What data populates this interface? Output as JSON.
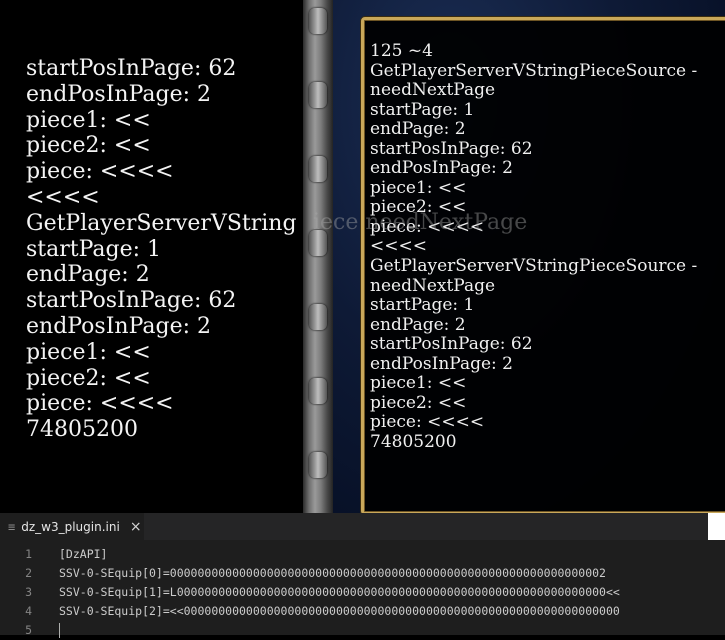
{
  "game": {
    "left_lines": [
      "startPosInPage: 62",
      "endPosInPage: 2",
      "piece1: <<",
      "piece2: <<",
      "piece: <<<<",
      "<<<<",
      "GetPlayerServerVString",
      "startPage: 1",
      "endPage: 2",
      "startPosInPage: 62",
      "endPosInPage: 2",
      "piece1: <<",
      "piece2: <<",
      "piece: <<<<",
      "74805200"
    ],
    "overlay_text": "iece needNextPage",
    "dialog_lines": [
      "125 ~4",
      "GetPlayerServerVStringPieceSource -",
      "needNextPage",
      "startPage: 1",
      "endPage: 2",
      "startPosInPage: 62",
      "endPosInPage: 2",
      "piece1: <<",
      "piece2: <<",
      "piece: <<<<",
      "<<<<",
      "GetPlayerServerVStringPieceSource -",
      "needNextPage",
      "startPage: 1",
      "endPage: 2",
      "startPosInPage: 62",
      "endPosInPage: 2",
      "piece1: <<",
      "piece2: <<",
      "piece: <<<<",
      "74805200"
    ]
  },
  "editor": {
    "tab": {
      "label": "dz_w3_plugin.ini",
      "icon": "≡",
      "close": "×"
    },
    "lines": [
      {
        "num": "1",
        "text": "[DzAPI]"
      },
      {
        "num": "2",
        "text": "SSV-0-SEquip[0]=000000000000000000000000000000000000000000000000000000000000002"
      },
      {
        "num": "3",
        "text": "SSV-0-SEquip[1]=L00000000000000000000000000000000000000000000000000000000000000<<"
      },
      {
        "num": "4",
        "text": "SSV-0-SEquip[2]=<<000000000000000000000000000000000000000000000000000000000000000"
      },
      {
        "num": "5",
        "text": ""
      }
    ]
  },
  "colors": {
    "dialog_border": "#c9a85a",
    "editor_bg": "#1e1e1e",
    "line_number": "#858585",
    "code_text": "#cccccc"
  }
}
